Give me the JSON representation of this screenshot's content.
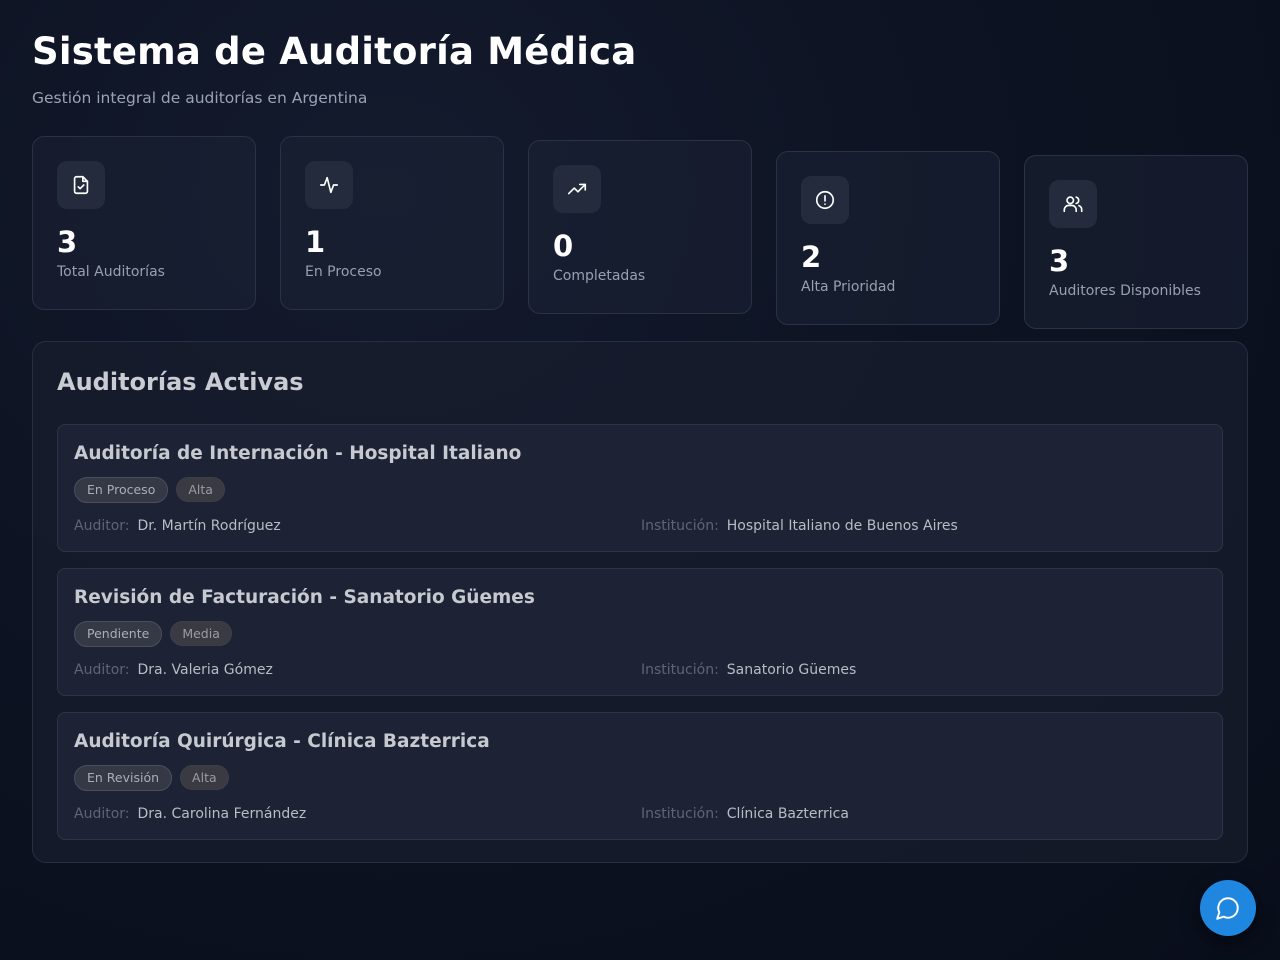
{
  "header": {
    "title": "Sistema de Auditoría Médica",
    "subtitle": "Gestión integral de auditorías en Argentina"
  },
  "stats": [
    {
      "icon": "file-check-icon",
      "value": "3",
      "label": "Total Auditorías"
    },
    {
      "icon": "activity-icon",
      "value": "1",
      "label": "En Proceso"
    },
    {
      "icon": "trending-up-icon",
      "value": "0",
      "label": "Completadas"
    },
    {
      "icon": "alert-circle-icon",
      "value": "2",
      "label": "Alta Prioridad"
    },
    {
      "icon": "users-icon",
      "value": "3",
      "label": "Auditores Disponibles"
    }
  ],
  "panel": {
    "title": "Auditorías Activas",
    "auditor_label": "Auditor:",
    "institution_label": "Institución:"
  },
  "audits": [
    {
      "title": "Auditoría de Internación - Hospital Italiano",
      "status": "En Proceso",
      "priority": "Alta",
      "auditor": "Dr. Martín Rodríguez",
      "institution": "Hospital Italiano de Buenos Aires"
    },
    {
      "title": "Revisión de Facturación - Sanatorio Güemes",
      "status": "Pendiente",
      "priority": "Media",
      "auditor": "Dra. Valeria Gómez",
      "institution": "Sanatorio Güemes"
    },
    {
      "title": "Auditoría Quirúrgica - Clínica Bazterrica",
      "status": "En Revisión",
      "priority": "Alta",
      "auditor": "Dra. Carolina Fernández",
      "institution": "Clínica Bazterrica"
    }
  ],
  "chat_button": {
    "icon": "chat-bubble-icon"
  },
  "colors": {
    "background": "#0d1322",
    "accent": "#1f87e0",
    "card_border": "#2a3245"
  }
}
